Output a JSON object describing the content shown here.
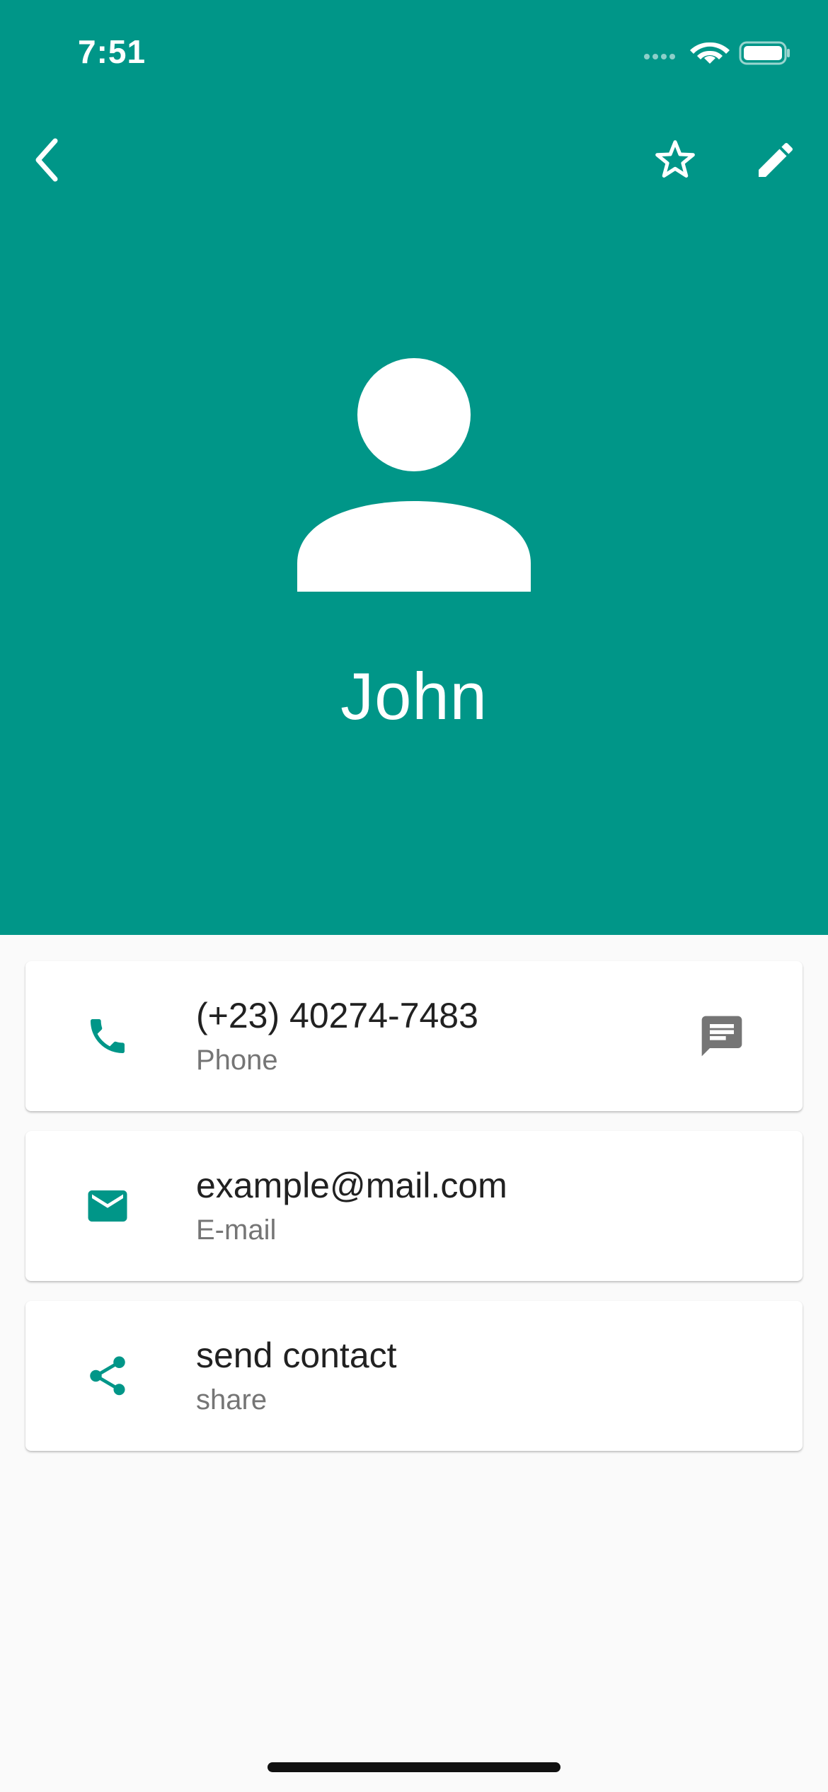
{
  "status_bar": {
    "time": "7:51"
  },
  "app_bar": {
    "back_icon": "chevron-left-icon",
    "favorite_icon": "star-outline-icon",
    "edit_icon": "pencil-icon"
  },
  "contact": {
    "name": "John",
    "avatar_icon": "person-icon"
  },
  "cards": [
    {
      "icon": "phone-icon",
      "title": "(+23) 40274-7483",
      "subtitle": "Phone",
      "action_icon": "message-icon"
    },
    {
      "icon": "email-icon",
      "title": "example@mail.com",
      "subtitle": "E-mail"
    },
    {
      "icon": "share-icon",
      "title": "send contact",
      "subtitle": "share"
    }
  ],
  "colors": {
    "primary": "#009688",
    "background": "#FAFAFA",
    "card": "#FFFFFF",
    "title_text": "#212121",
    "subtitle_text": "#757575",
    "action_icon": "#757575"
  }
}
